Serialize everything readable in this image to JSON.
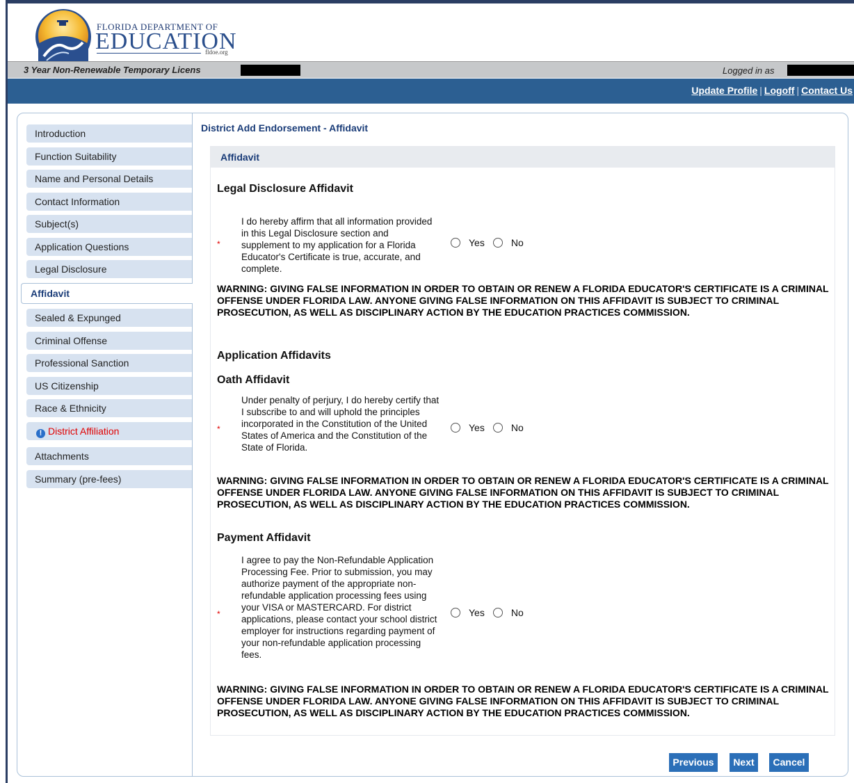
{
  "header": {
    "logo_line1": "FLORIDA DEPARTMENT OF",
    "logo_line2": "EDUCATION",
    "logo_line3": "fldoe.org",
    "application_title": "3 Year Non-Renewable Temporary Licens",
    "logged_in_label": "Logged in as",
    "nav_links": [
      "Update Profile",
      "Logoff",
      "Contact Us"
    ],
    "nav_separator": "|"
  },
  "sidebar": {
    "items": [
      {
        "label": "Introduction"
      },
      {
        "label": "Function Suitability"
      },
      {
        "label": "Name and Personal Details"
      },
      {
        "label": "Contact Information"
      },
      {
        "label": "Subject(s)"
      },
      {
        "label": "Application Questions"
      },
      {
        "label": "Legal Disclosure"
      },
      {
        "label": "Affidavit",
        "state": "active"
      },
      {
        "label": "Sealed & Expunged"
      },
      {
        "label": "Criminal Offense"
      },
      {
        "label": "Professional Sanction"
      },
      {
        "label": "US Citizenship"
      },
      {
        "label": "Race & Ethnicity"
      },
      {
        "label": "District Affiliation",
        "state": "error",
        "icon": "info-icon"
      },
      {
        "label": "Attachments"
      },
      {
        "label": "Summary (pre-fees)"
      }
    ]
  },
  "main": {
    "page_title": "District Add Endorsement - Affidavit",
    "panel_title": "Affidavit",
    "legal_heading": "Legal Disclosure Affidavit",
    "application_heading": "Application Affidavits",
    "required_marker": "*",
    "yes_label": "Yes",
    "no_label": "No",
    "affidavits": [
      {
        "heading": "",
        "text": "I do hereby affirm that all information provided in this Legal Disclosure section and supplement to my application for a Florida Educator's Certificate is true, accurate, and complete.",
        "selected": null
      },
      {
        "heading": "Oath Affidavit",
        "text": "Under penalty of perjury, I do hereby certify that I subscribe to and will uphold the principles incorporated in the Constitution of the United States of America and the Constitution of the State of Florida.",
        "selected": null
      },
      {
        "heading": "Payment Affidavit",
        "text": "I agree to pay the Non-Refundable Application Processing Fee. Prior to submission, you may authorize payment of the appropriate non-refundable application processing fees using your VISA or MASTERCARD. For district applications, please contact your school district employer for instructions regarding payment of your non-refundable application processing fees.",
        "selected": null
      }
    ],
    "warning": "WARNING: GIVING FALSE INFORMATION IN ORDER TO OBTAIN OR RENEW A FLORIDA EDUCATOR'S CERTIFICATE IS A CRIMINAL OFFENSE UNDER FLORIDA LAW. ANYONE GIVING FALSE INFORMATION ON THIS AFFIDAVIT IS SUBJECT TO CRIMINAL PROSECUTION, AS WELL AS DISCIPLINARY ACTION BY THE EDUCATION PRACTICES COMMISSION."
  },
  "buttons": {
    "previous": "Previous",
    "next": "Next",
    "cancel": "Cancel"
  },
  "colors": {
    "nav_bar": "#2c5f92",
    "header_border": "#2b3e63",
    "sidebar_item_bg": "#d7e2f0",
    "accent_text": "#1a3c78",
    "error": "#e00000",
    "button": "#2b6fb8"
  }
}
